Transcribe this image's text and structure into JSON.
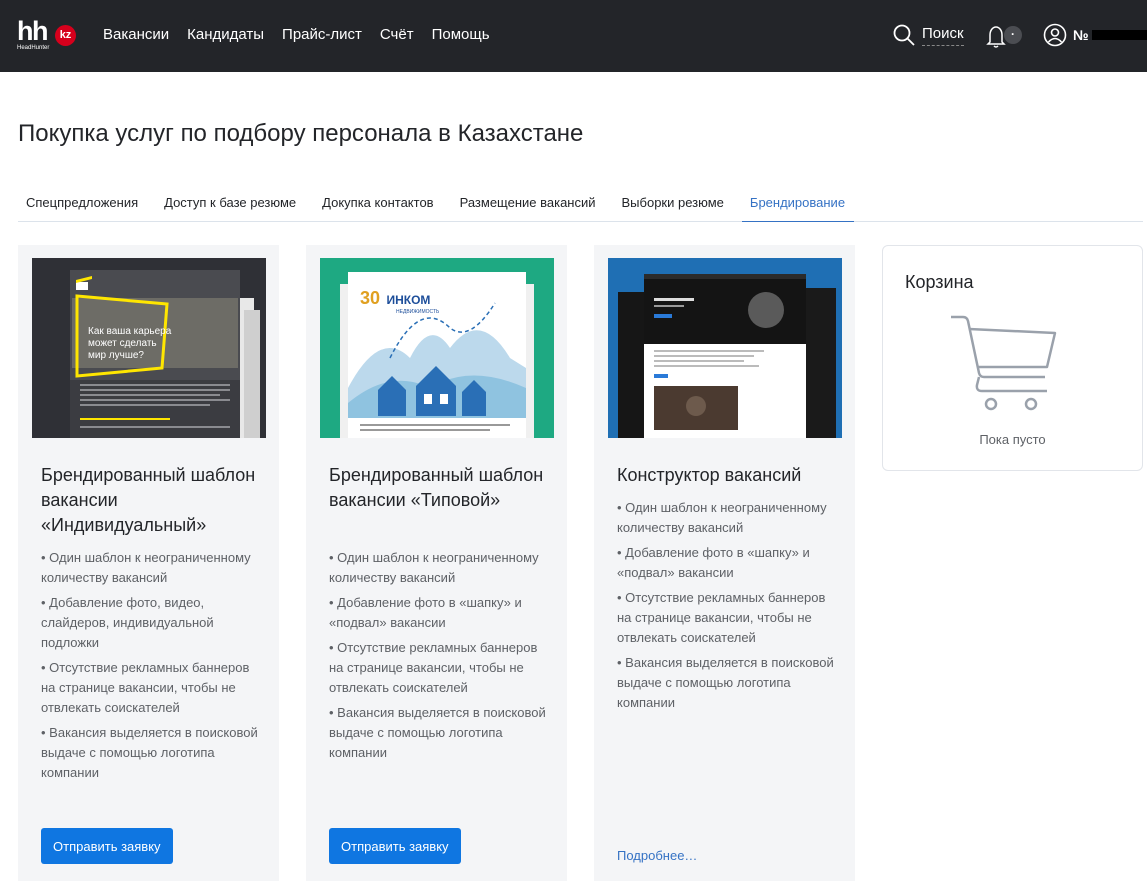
{
  "header": {
    "logo_text": "hh",
    "logo_badge": "kz",
    "logo_sub": "HeadHunter",
    "nav": [
      "Вакансии",
      "Кандидаты",
      "Прайс-лист",
      "Счёт",
      "Помощь"
    ],
    "search_label": "Поиск",
    "notification_count": "·",
    "user_label": "№"
  },
  "page": {
    "title": "Покупка услуг по подбору персонала в Казахстане",
    "tabs": [
      "Спецпредложения",
      "Доступ к базе резюме",
      "Докупка контактов",
      "Размещение вакансий",
      "Выборки резюме",
      "Брендирование"
    ],
    "active_tab": "Брендирование"
  },
  "cards": [
    {
      "title": "Брендированный шаблон вакансии «Индивидуальный»",
      "thumb_text": [
        "Как ваша карьера",
        "может сделать",
        "мир лучше?"
      ],
      "bullets": [
        "• Один шаблон к неограниченному количеству вакансий",
        "• Добавление фото, видео, слайдеров, индивидуальной подложки",
        "• Отсутствие рекламных баннеров на странице вакансии, чтобы не отвлекать соискателей",
        "• Вакансия выделяется в поисковой выдаче с помощью логотипа компании"
      ],
      "button": "Отправить заявку"
    },
    {
      "title": "Брендированный шаблон вакансии «Типовой»",
      "thumb_text": [
        "30",
        "ИНКОМ",
        "НЕДВИЖИМОСТЬ"
      ],
      "bullets": [
        "• Один шаблон к неограниченному количеству вакансий",
        "• Добавление фото в «шапку» и «подвал» вакансии",
        "• Отсутствие рекламных баннеров на странице вакансии, чтобы не отвлекать соискателей",
        "• Вакансия выделяется в поисковой выдаче с помощью логотипа компании"
      ],
      "button": "Отправить заявку"
    },
    {
      "title": "Конструктор вакансий",
      "bullets": [
        "• Один шаблон к неограниченному количеству вакансий",
        "• Добавление фото в «шапку» и «подвал» вакансии",
        "• Отсутствие рекламных баннеров на странице вакансии, чтобы не отвлекать соискателей",
        "• Вакансия выделяется в поисковой выдаче с помощью логотипа компании"
      ],
      "link": "Подробнее…"
    }
  ],
  "cart": {
    "title": "Корзина",
    "empty_text": "Пока пусто"
  },
  "colors": {
    "header_bg": "#232529",
    "accent": "#3572c4",
    "button": "#0f76e1",
    "card_bg": "#f4f5f7",
    "logo_red": "#d6001c"
  }
}
